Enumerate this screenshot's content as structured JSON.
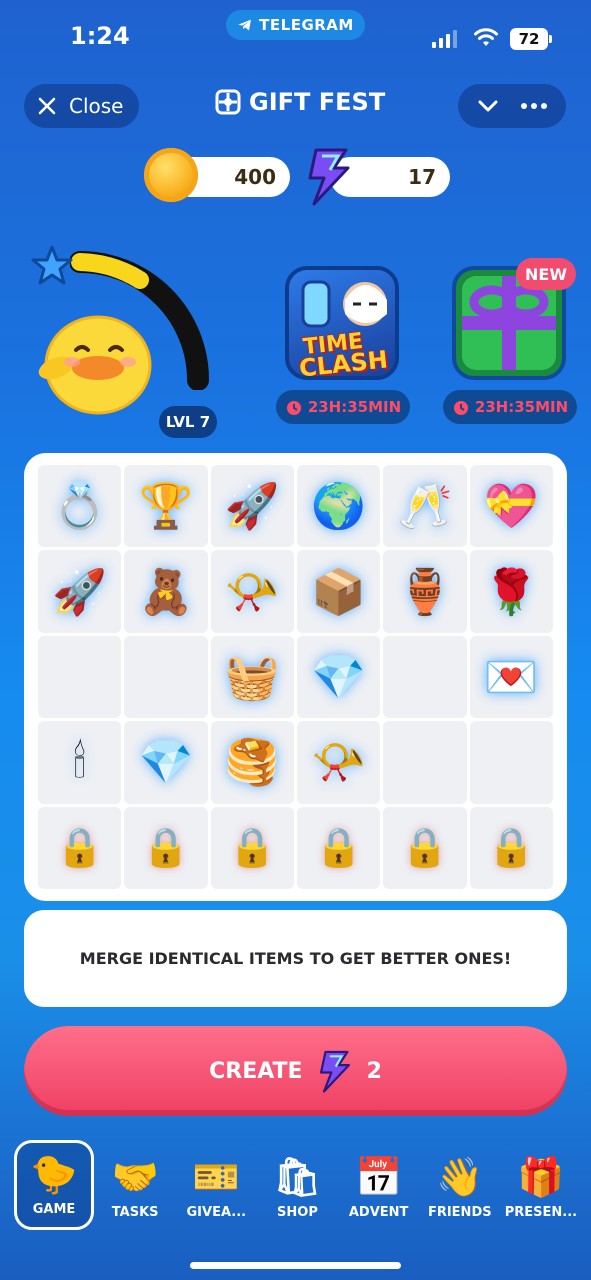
{
  "status_bar": {
    "time": "1:24",
    "app_pill": "TELEGRAM",
    "battery": "72"
  },
  "header": {
    "close_label": "Close",
    "title": "GIFT FEST"
  },
  "currency": {
    "coins": "400",
    "energy": "17"
  },
  "level": {
    "label": "LVL 7",
    "progress": 0.6
  },
  "events": [
    {
      "name": "Time Clash",
      "title_line1": "TIME",
      "title_line2": "CLASH",
      "timer": "23H:35MIN"
    },
    {
      "name": "Gift",
      "badge": "NEW",
      "timer": "23H:35MIN"
    }
  ],
  "grid": [
    [
      "💍",
      "🏆",
      "🚀",
      "🌍",
      "🥂",
      "💝"
    ],
    [
      "🚀",
      "🧸",
      "📯",
      "📦",
      "🏺",
      "🌹"
    ],
    [
      "",
      "",
      "🧺",
      "💎",
      "",
      "💌"
    ],
    [
      "🕯",
      "💎",
      "🥞",
      "📯",
      "",
      ""
    ],
    [
      "🔒",
      "🔒",
      "🔒",
      "🔒",
      "🔒",
      "🔒"
    ]
  ],
  "hint": "MERGE IDENTICAL ITEMS TO GET BETTER ONES!",
  "create": {
    "label": "CREATE",
    "cost": "2"
  },
  "nav": [
    {
      "label": "GAME",
      "icon": "🐤",
      "active": true
    },
    {
      "label": "TASKS",
      "icon": "🤝"
    },
    {
      "label": "GIVEA...",
      "icon": "🎫"
    },
    {
      "label": "SHOP",
      "icon": "🛍"
    },
    {
      "label": "ADVENT",
      "icon": "📅"
    },
    {
      "label": "FRIENDS",
      "icon": "👋"
    },
    {
      "label": "PRESEN...",
      "icon": "🎁"
    }
  ]
}
